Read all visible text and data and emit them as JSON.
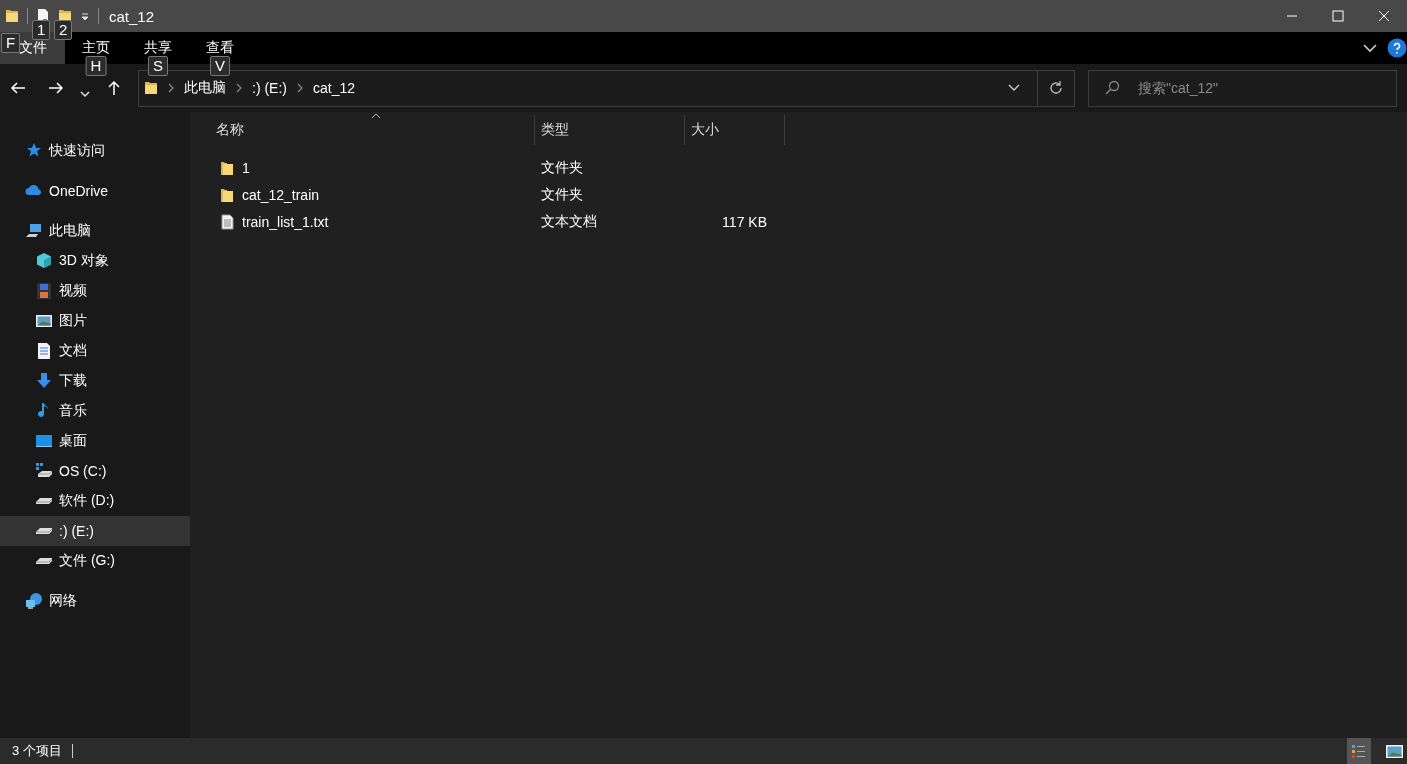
{
  "window": {
    "title": "cat_12"
  },
  "quick_access_keytips": [
    "1",
    "2"
  ],
  "ribbon": {
    "tabs": [
      {
        "label": "文件",
        "keytip": "F",
        "kind": "file",
        "selected": false
      },
      {
        "label": "主页",
        "keytip": "H",
        "kind": "tab",
        "selected": false
      },
      {
        "label": "共享",
        "keytip": "S",
        "kind": "tab",
        "selected": false
      },
      {
        "label": "查看",
        "keytip": "V",
        "kind": "tab",
        "selected": false
      }
    ]
  },
  "address_bar": {
    "path": [
      "此电脑",
      ":) (E:)",
      "cat_12"
    ]
  },
  "search": {
    "placeholder": "搜索\"cat_12\""
  },
  "navigation": {
    "items": [
      {
        "label": "快速访问",
        "kind": "star",
        "selected": false
      },
      {
        "label": "OneDrive",
        "kind": "cloud",
        "selected": false
      },
      {
        "label": "此电脑",
        "kind": "computer",
        "selected": false,
        "children": [
          {
            "label": "3D 对象",
            "kind": "cube",
            "selected": false
          },
          {
            "label": "视频",
            "kind": "film",
            "selected": false
          },
          {
            "label": "图片",
            "kind": "image",
            "selected": false
          },
          {
            "label": "文档",
            "kind": "document",
            "selected": false
          },
          {
            "label": "下载",
            "kind": "download",
            "selected": false
          },
          {
            "label": "音乐",
            "kind": "music",
            "selected": false
          },
          {
            "label": "桌面",
            "kind": "desktop",
            "selected": false
          },
          {
            "label": "OS (C:)",
            "kind": "system-drive",
            "selected": false
          },
          {
            "label": "软件 (D:)",
            "kind": "drive",
            "selected": false
          },
          {
            "label": ":) (E:)",
            "kind": "drive",
            "selected": true
          },
          {
            "label": "文件 (G:)",
            "kind": "drive",
            "selected": false
          }
        ]
      },
      {
        "label": "网络",
        "kind": "network",
        "selected": false
      }
    ]
  },
  "file_list": {
    "columns": [
      {
        "label": "名称",
        "sorted": true
      },
      {
        "label": "类型",
        "sorted": false
      },
      {
        "label": "大小",
        "sorted": false
      }
    ],
    "rows": [
      {
        "name": "1",
        "type": "文件夹",
        "size": "",
        "kind": "folder"
      },
      {
        "name": "cat_12_train",
        "type": "文件夹",
        "size": "",
        "kind": "folder"
      },
      {
        "name": "train_list_1.txt",
        "type": "文本文档",
        "size": "117 KB",
        "kind": "text"
      }
    ]
  },
  "status_bar": {
    "text": "3 个项目",
    "views": [
      {
        "kind": "details",
        "selected": true
      },
      {
        "kind": "large-icons",
        "selected": false
      }
    ]
  }
}
